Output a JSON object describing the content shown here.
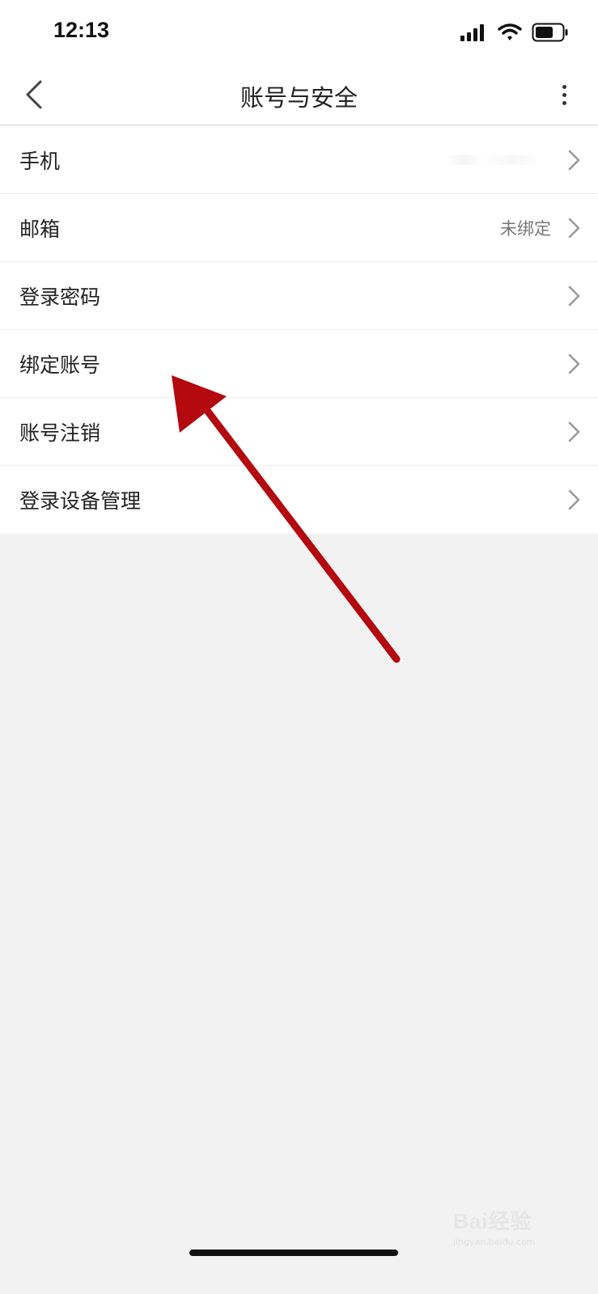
{
  "status_bar": {
    "time": "12:13",
    "icons": [
      "signal-icon",
      "wifi-icon",
      "battery-icon"
    ]
  },
  "nav": {
    "title": "账号与安全",
    "back_icon": "chevron-left-icon",
    "more_icon": "more-vertical-icon"
  },
  "settings": {
    "items": [
      {
        "label": "手机",
        "value": ""
      },
      {
        "label": "邮箱",
        "value": "未绑定"
      },
      {
        "label": "登录密码",
        "value": ""
      },
      {
        "label": "绑定账号",
        "value": ""
      },
      {
        "label": "账号注销",
        "value": ""
      },
      {
        "label": "登录设备管理",
        "value": ""
      }
    ]
  },
  "annotation": {
    "arrow_color": "#b3090f"
  },
  "watermark": {
    "main": "Bai经验",
    "sub": "jingyan.baidu.com"
  },
  "colors": {
    "background": "#f2f2f2",
    "surface": "#ffffff",
    "divider": "#ededed",
    "secondary_text": "#777777"
  }
}
